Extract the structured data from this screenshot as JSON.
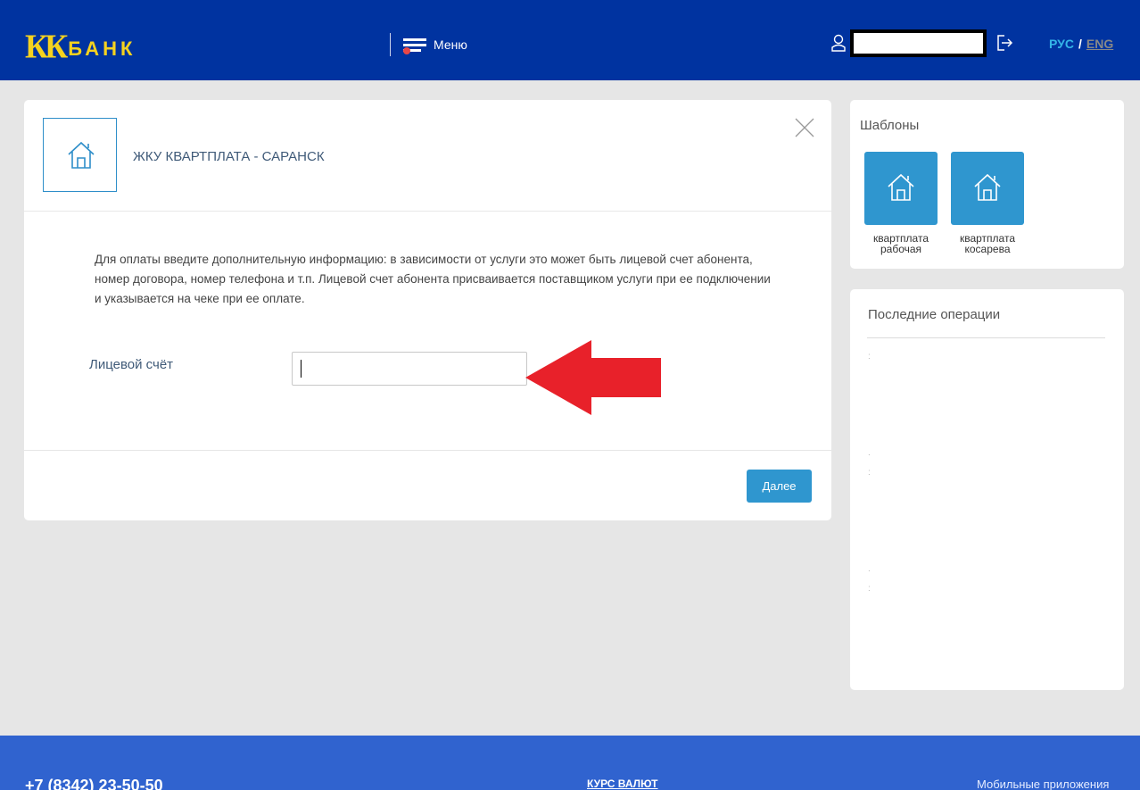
{
  "header": {
    "logo_mark": "КК",
    "logo_word": "БАНК",
    "menu_label": "Меню",
    "lang_ru": "РУС",
    "lang_sep": "/",
    "lang_en": "ENG"
  },
  "service": {
    "title": "ЖКУ КВАРТПЛАТА - САРАНСК",
    "description": "Для оплаты введите дополнительную информацию: в зависимости от услуги это может быть лицевой счет абонента, номер договора, номер телефона и т.п. Лицевой счет абонента присваивается поставщиком услуги при ее подключении и указывается на чеке при ее оплате.",
    "field_label": "Лицевой счёт",
    "field_value": "",
    "next_button": "Далее"
  },
  "templates": {
    "title": "Шаблоны",
    "items": [
      {
        "label_line1": "квартплата",
        "label_line2": "рабочая"
      },
      {
        "label_line1": "квартплата",
        "label_line2": "косарева"
      }
    ]
  },
  "recent": {
    "title": "Последние операции"
  },
  "footer": {
    "phone": "+7 (8342) 23-50-50",
    "rates": "КУРС ВАЛЮТ",
    "mobile": "Мобильные приложения"
  },
  "colors": {
    "header_bg": "#0033a0",
    "logo": "#f5d21f",
    "accent": "#2f96cf",
    "footer_bg": "#3063cf",
    "arrow": "#e8212a"
  }
}
